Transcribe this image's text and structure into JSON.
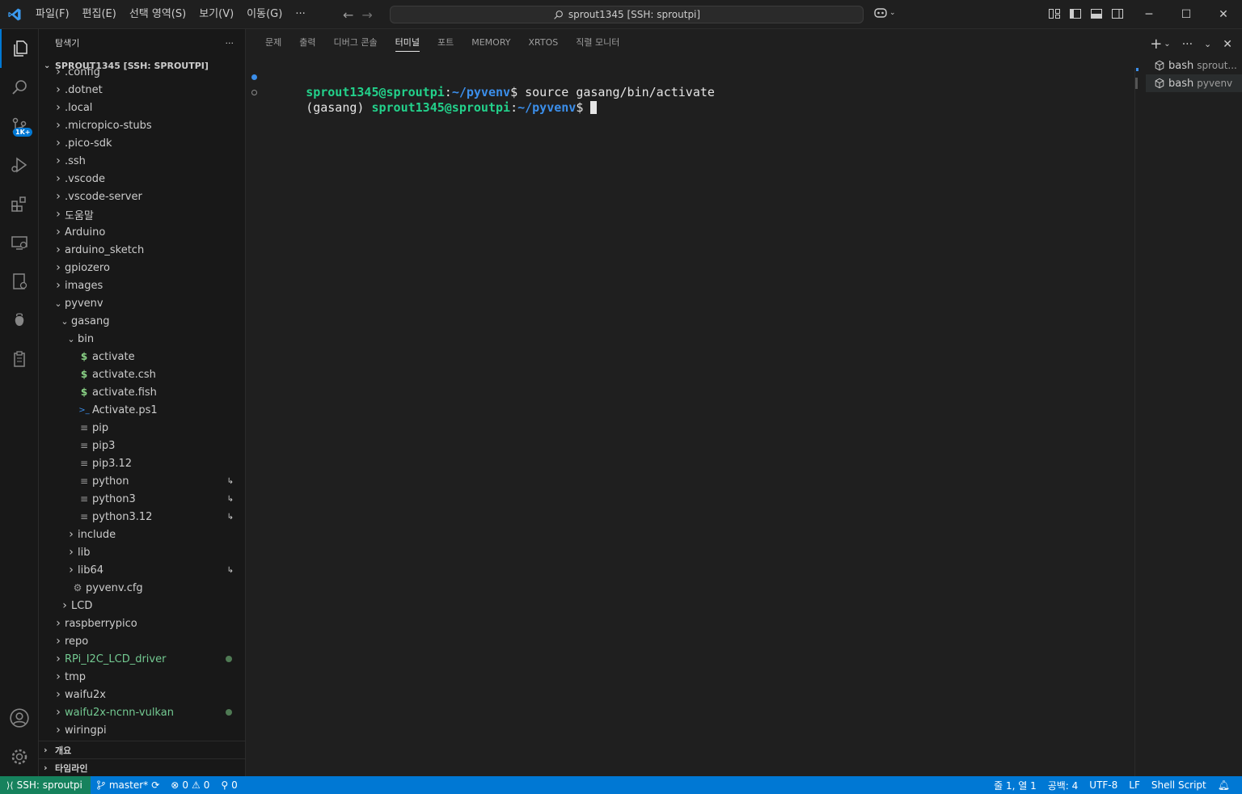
{
  "menu": [
    "파일(F)",
    "편집(E)",
    "선택 영역(S)",
    "보기(V)",
    "이동(G)",
    "···"
  ],
  "command_center": "sprout1345 [SSH: sproutpi]",
  "colors": {
    "accent": "#0078d4",
    "remote": "#16825d",
    "green": "#23d18b",
    "blue": "#3b8eea",
    "git_untracked": "#73c991"
  },
  "activity": {
    "scm_badge": "1K+"
  },
  "sidebar": {
    "title": "탐색기",
    "more": "···",
    "root": "SPROUT1345 [SSH: SPROUTPI]",
    "tree": [
      {
        "label": ".config",
        "depth": 0,
        "type": "folder",
        "open": false
      },
      {
        "label": ".dotnet",
        "depth": 0,
        "type": "folder",
        "open": false
      },
      {
        "label": ".local",
        "depth": 0,
        "type": "folder",
        "open": false
      },
      {
        "label": ".micropico-stubs",
        "depth": 0,
        "type": "folder",
        "open": false
      },
      {
        "label": ".pico-sdk",
        "depth": 0,
        "type": "folder",
        "open": false
      },
      {
        "label": ".ssh",
        "depth": 0,
        "type": "folder",
        "open": false
      },
      {
        "label": ".vscode",
        "depth": 0,
        "type": "folder",
        "open": false
      },
      {
        "label": ".vscode-server",
        "depth": 0,
        "type": "folder",
        "open": false
      },
      {
        "label": "도움말",
        "depth": 0,
        "type": "folder",
        "open": false
      },
      {
        "label": "Arduino",
        "depth": 0,
        "type": "folder",
        "open": false
      },
      {
        "label": "arduino_sketch",
        "depth": 0,
        "type": "folder",
        "open": false
      },
      {
        "label": "gpiozero",
        "depth": 0,
        "type": "folder",
        "open": false
      },
      {
        "label": "images",
        "depth": 0,
        "type": "folder",
        "open": false
      },
      {
        "label": "pyvenv",
        "depth": 0,
        "type": "folder",
        "open": true
      },
      {
        "label": "gasang",
        "depth": 1,
        "type": "folder",
        "open": true
      },
      {
        "label": "bin",
        "depth": 2,
        "type": "folder",
        "open": true
      },
      {
        "label": "activate",
        "depth": 3,
        "type": "shell"
      },
      {
        "label": "activate.csh",
        "depth": 3,
        "type": "shell"
      },
      {
        "label": "activate.fish",
        "depth": 3,
        "type": "shell"
      },
      {
        "label": "Activate.ps1",
        "depth": 3,
        "type": "powershell"
      },
      {
        "label": "pip",
        "depth": 3,
        "type": "file"
      },
      {
        "label": "pip3",
        "depth": 3,
        "type": "file"
      },
      {
        "label": "pip3.12",
        "depth": 3,
        "type": "file"
      },
      {
        "label": "python",
        "depth": 3,
        "type": "file",
        "symlink": true
      },
      {
        "label": "python3",
        "depth": 3,
        "type": "file",
        "symlink": true
      },
      {
        "label": "python3.12",
        "depth": 3,
        "type": "file",
        "symlink": true
      },
      {
        "label": "include",
        "depth": 2,
        "type": "folder",
        "open": false
      },
      {
        "label": "lib",
        "depth": 2,
        "type": "folder",
        "open": false
      },
      {
        "label": "lib64",
        "depth": 2,
        "type": "folder",
        "open": false,
        "symlink": true
      },
      {
        "label": "pyvenv.cfg",
        "depth": 2,
        "type": "config"
      },
      {
        "label": "LCD",
        "depth": 1,
        "type": "folder",
        "open": false
      },
      {
        "label": "raspberrypico",
        "depth": 0,
        "type": "folder",
        "open": false
      },
      {
        "label": "repo",
        "depth": 0,
        "type": "folder",
        "open": false
      },
      {
        "label": "RPi_I2C_LCD_driver",
        "depth": 0,
        "type": "folder",
        "open": false,
        "git": true
      },
      {
        "label": "tmp",
        "depth": 0,
        "type": "folder",
        "open": false
      },
      {
        "label": "waifu2x",
        "depth": 0,
        "type": "folder",
        "open": false
      },
      {
        "label": "waifu2x-ncnn-vulkan",
        "depth": 0,
        "type": "folder",
        "open": false,
        "git": true
      },
      {
        "label": "wiringpi",
        "depth": 0,
        "type": "folder",
        "open": false
      }
    ],
    "outline": "개요",
    "timeline": "타임라인"
  },
  "panel": {
    "tabs": [
      "문제",
      "출력",
      "디버그 콘솔",
      "터미널",
      "포트",
      "MEMORY",
      "XRTOS",
      "직렬 모니터"
    ],
    "active_tab": "터미널",
    "terminal": {
      "line1": {
        "user": "sprout1345@sproutpi",
        "colon": ":",
        "path": "~/pyvenv",
        "prompt": "$",
        "cmd": " source gasang/bin/activate"
      },
      "line2": {
        "venv": "(gasang) ",
        "user": "sprout1345@sproutpi",
        "colon": ":",
        "path": "~/pyvenv",
        "prompt": "$ "
      }
    },
    "terminals": [
      {
        "name": "bash",
        "desc": "sprout..."
      },
      {
        "name": "bash",
        "desc": "pyvenv"
      }
    ]
  },
  "status": {
    "remote": "SSH: sproutpi",
    "branch": "master*",
    "errors": "0",
    "warnings": "0",
    "ports": "0",
    "position": "줄 1, 열 1",
    "spaces": "공백: 4",
    "encoding": "UTF-8",
    "eol": "LF",
    "language": "Shell Script"
  }
}
